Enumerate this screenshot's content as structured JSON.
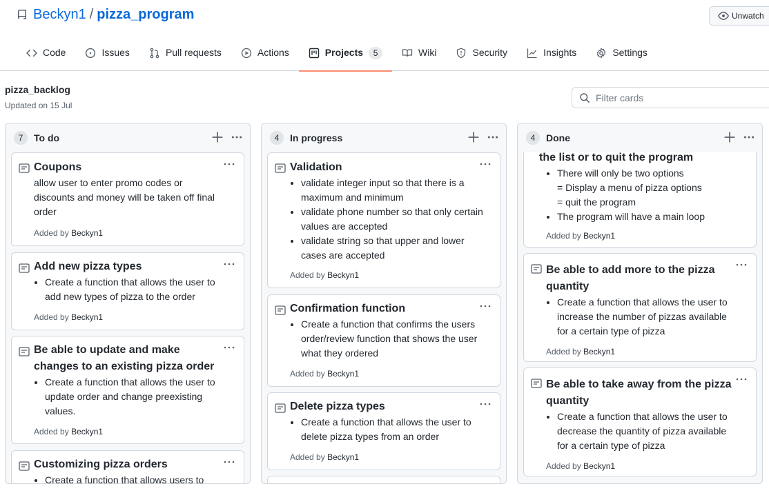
{
  "repo": {
    "owner": "Beckyn1",
    "separator": "/",
    "name": "pizza_program",
    "watch_label": "Unwatch"
  },
  "tabs": [
    {
      "label": "Code",
      "icon": "code-icon"
    },
    {
      "label": "Issues",
      "icon": "issue-opened-icon"
    },
    {
      "label": "Pull requests",
      "icon": "git-pull-request-icon"
    },
    {
      "label": "Actions",
      "icon": "play-icon"
    },
    {
      "label": "Projects",
      "icon": "project-icon",
      "count": "5",
      "selected": true
    },
    {
      "label": "Wiki",
      "icon": "book-icon"
    },
    {
      "label": "Security",
      "icon": "shield-icon"
    },
    {
      "label": "Insights",
      "icon": "graph-icon"
    },
    {
      "label": "Settings",
      "icon": "gear-icon"
    }
  ],
  "project": {
    "name": "pizza_backlog",
    "updated": "Updated on 15 Jul",
    "filter_placeholder": "Filter cards"
  },
  "added_by_prefix": "Added by",
  "columns": [
    {
      "count": "7",
      "title": "To do",
      "cards": [
        {
          "title": "Coupons",
          "text": "allow user to enter promo codes or discounts and money will be taken off final order",
          "author": "Beckyn1"
        },
        {
          "title": "Add new pizza types",
          "bullets": [
            "Create a function that allows the user to add new types of pizza to the order"
          ],
          "author": "Beckyn1"
        },
        {
          "title": "Be able to update and make changes to an existing pizza order",
          "bullets": [
            "Create a function that allows the user to update order and change preexisting values."
          ],
          "author": "Beckyn1"
        },
        {
          "title": "Customizing pizza orders",
          "bullets": [
            "Create a function that allows users to"
          ],
          "author": ""
        }
      ]
    },
    {
      "count": "4",
      "title": "In progress",
      "cards": [
        {
          "title": "Validation",
          "bullets": [
            "validate integer input so that there is a maximum and minimum",
            "validate phone number so that only certain values are accepted",
            "validate string so that upper and lower cases are accepted"
          ],
          "author": "Beckyn1"
        },
        {
          "title": "Confirmation function",
          "bullets": [
            "Create a function that confirms the users order/review function that shows the user what they ordered"
          ],
          "author": "Beckyn1"
        },
        {
          "title": "Delete pizza types",
          "bullets": [
            "Create a function that allows the user to delete pizza types from an order"
          ],
          "author": "Beckyn1"
        }
      ]
    },
    {
      "count": "4",
      "title": "Done",
      "cards": [
        {
          "title": "the list or to quit the program",
          "bullets": [
            "There will only be two options"
          ],
          "sublines": [
            "= Display a menu of pizza options",
            "= quit the program"
          ],
          "bullets2": [
            "The program will have a main loop"
          ],
          "author": "Beckyn1"
        },
        {
          "title": "Be able to add more to the pizza quantity",
          "bullets": [
            "Create a function that allows the user to increase the number of pizzas available for a certain type of pizza"
          ],
          "author": "Beckyn1"
        },
        {
          "title": "Be able to take away from the pizza quantity",
          "bullets": [
            "Create a function that allows the user to decrease the quantity of pizza available for a certain type of pizza"
          ],
          "author": "Beckyn1"
        }
      ]
    }
  ]
}
